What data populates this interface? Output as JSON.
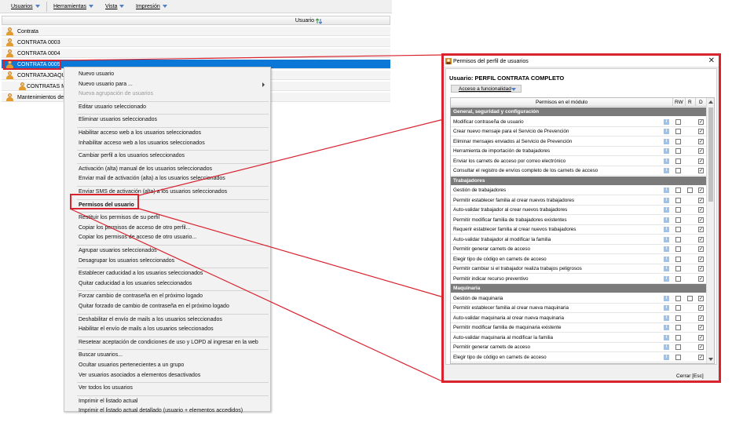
{
  "menubar": [
    {
      "label": "Usuarios"
    },
    {
      "label": "Herramientas"
    },
    {
      "label": "Vista"
    },
    {
      "label": "Impresión"
    }
  ],
  "list": {
    "column_header": "Usuario",
    "rows": [
      {
        "label": "Contrata",
        "selected": false,
        "indent": false
      },
      {
        "label": "CONTRATA 0003",
        "selected": false,
        "indent": false
      },
      {
        "label": "CONTRATA 0004",
        "selected": false,
        "indent": false
      },
      {
        "label": "CONTRATA 0005",
        "selected": true,
        "indent": false
      },
      {
        "label": "CONTRATAJOAQUIN",
        "selected": false,
        "indent": false
      },
      {
        "label": "CONTRATAS MA",
        "selected": false,
        "indent": true
      },
      {
        "label": "Mantenimientos de pa",
        "selected": false,
        "indent": false
      }
    ]
  },
  "context_menu": {
    "groups": [
      [
        {
          "label": "Nuevo usuario"
        },
        {
          "label": "Nuevo usuario para ...",
          "submenu": true
        },
        {
          "label": "Nueva agrupación de usuarios",
          "disabled": true
        }
      ],
      [
        {
          "label": "Editar usuario seleccionado"
        }
      ],
      [
        {
          "label": "Eliminar usuarios seleccionados"
        }
      ],
      [
        {
          "label": "Habilitar acceso web a los usuarios seleccionados"
        },
        {
          "label": "Inhabilitar acceso web a los usuarios seleccionados"
        }
      ],
      [
        {
          "label": "Cambiar perfil a los usuarios seleccionados"
        }
      ],
      [
        {
          "label": "Activación (alta) manual de los usuarios seleccionados"
        },
        {
          "label": "Enviar mail de activación (alta) a los usuarios seleccionados"
        }
      ],
      [
        {
          "label": "Enviar SMS de activación (alta) a los usuarios seleccionados"
        }
      ],
      [
        {
          "label": "Permisos del usuario",
          "bold": true
        }
      ],
      [
        {
          "label": "Restituir los permisos de su perfil"
        },
        {
          "label": "Copiar los permisos de acceso de otro perfil..."
        },
        {
          "label": "Copiar los permisos de acceso de otro usuario..."
        }
      ],
      [
        {
          "label": "Agrupar usuarios seleccionados"
        },
        {
          "label": "Desagrupar los usuarios seleccionados"
        }
      ],
      [
        {
          "label": "Establecer caducidad a los usuarios seleccionados"
        },
        {
          "label": "Quitar caducidad a los usuarios seleccionados"
        }
      ],
      [
        {
          "label": "Forzar cambio de contraseña en el próximo logado"
        },
        {
          "label": "Quitar forzado de cambio de contraseña en el próximo logado"
        }
      ],
      [
        {
          "label": "Deshabilitar el envío de mails a los usuarios seleccionados"
        },
        {
          "label": "Habilitar el envío de mails a los usuarios seleccionados"
        }
      ],
      [
        {
          "label": "Resetear aceptación de condiciones de uso y LOPD al ingresar en la web"
        }
      ],
      [
        {
          "label": "Buscar usuarios..."
        },
        {
          "label": "Ocultar usuarios pertenecientes a un grupo"
        },
        {
          "label": "Ver usuarios asociados a elementos desactivados"
        }
      ],
      [
        {
          "label": "Ver todos los usuarios"
        }
      ],
      [
        {
          "label": "Imprimir el listado actual"
        },
        {
          "label": "Imprimir el listado actual detallado (usuario + elementos accedidos)"
        }
      ]
    ]
  },
  "dialog": {
    "title": "Permisos del perfil de usuarios",
    "user_label": "Usuario: PERFIL CONTRATA COMPLETO",
    "access_button": "Acceso a funcionalidad",
    "columns": {
      "module": "Permisos en el módulo",
      "rw": "RW",
      "r": "R",
      "d": "D"
    },
    "close_label": "Cerrar  [Esc]",
    "info_glyph": "i",
    "check_glyph": "✓",
    "sections": [
      {
        "title": "General, seguridad y configuración",
        "rows": [
          {
            "label": "Modificar contraseña de usuario",
            "rw": false,
            "d": true
          },
          {
            "label": "Crear nuevo mensaje para el Servicio de Prevención",
            "rw": false,
            "d": true
          },
          {
            "label": "Eliminar mensajes enviados al Servicio de Prevención",
            "rw": false,
            "d": true
          },
          {
            "label": "Herramienta de importación de trabajadores",
            "rw": false,
            "d": true
          },
          {
            "label": "Enviar los carnets de acceso por correo electrónico",
            "rw": false,
            "d": true
          },
          {
            "label": "Consultar el registro de envíos completo de los carnets de acceso",
            "rw": false,
            "d": true
          }
        ]
      },
      {
        "title": "Trabajadores",
        "rows": [
          {
            "label": "Gestión de trabajadores",
            "rw": false,
            "r": false,
            "d": true
          },
          {
            "label": "Permitir establecer familia al crear nuevos trabajadores",
            "rw": false,
            "d": true
          },
          {
            "label": "Auto-validar trabajador al crear nuevos trabajadores",
            "rw": false,
            "d": true
          },
          {
            "label": "Permitir modificar familia de trabajadores existentes",
            "rw": false,
            "d": true
          },
          {
            "label": "Requerir establecer familia al crear nuevos trabajadores",
            "rw": false,
            "d": true
          },
          {
            "label": "Auto-validar trabajador al modificar la familia",
            "rw": false,
            "d": true
          },
          {
            "label": "Permitir generar carnets de acceso",
            "rw": false,
            "d": true
          },
          {
            "label": "Elegir tipo de código en carnets de acceso",
            "rw": false,
            "d": true
          },
          {
            "label": "Permitir cambiar si el trabajador realiza trabajos peligrosos",
            "rw": false,
            "d": true
          },
          {
            "label": "Permitir indicar recurso preventivo",
            "rw": false,
            "d": true
          }
        ]
      },
      {
        "title": "Maquinaria",
        "rows": [
          {
            "label": "Gestión de maquinaria",
            "rw": false,
            "r": false,
            "d": true
          },
          {
            "label": "Permitir establecer familia al crear nueva maquinaria",
            "rw": false,
            "d": true
          },
          {
            "label": "Auto-validar maquinaria al crear nueva maquinaria",
            "rw": false,
            "d": true
          },
          {
            "label": "Permitir modificar familia de maquinaria existente",
            "rw": false,
            "d": true
          },
          {
            "label": "Auto-validar maquinaria al modificar la familia",
            "rw": false,
            "d": true
          },
          {
            "label": "Permitir generar carnets de acceso",
            "rw": false,
            "d": true
          },
          {
            "label": "Elegir tipo de código en carnets de acceso",
            "rw": false,
            "d": true
          }
        ]
      }
    ]
  },
  "colors": {
    "highlight_red": "#d9232f",
    "selection_blue": "#0b78d7",
    "group_header_gray": "#7b7b7b",
    "info_icon_blue": "#9dc3ea"
  }
}
